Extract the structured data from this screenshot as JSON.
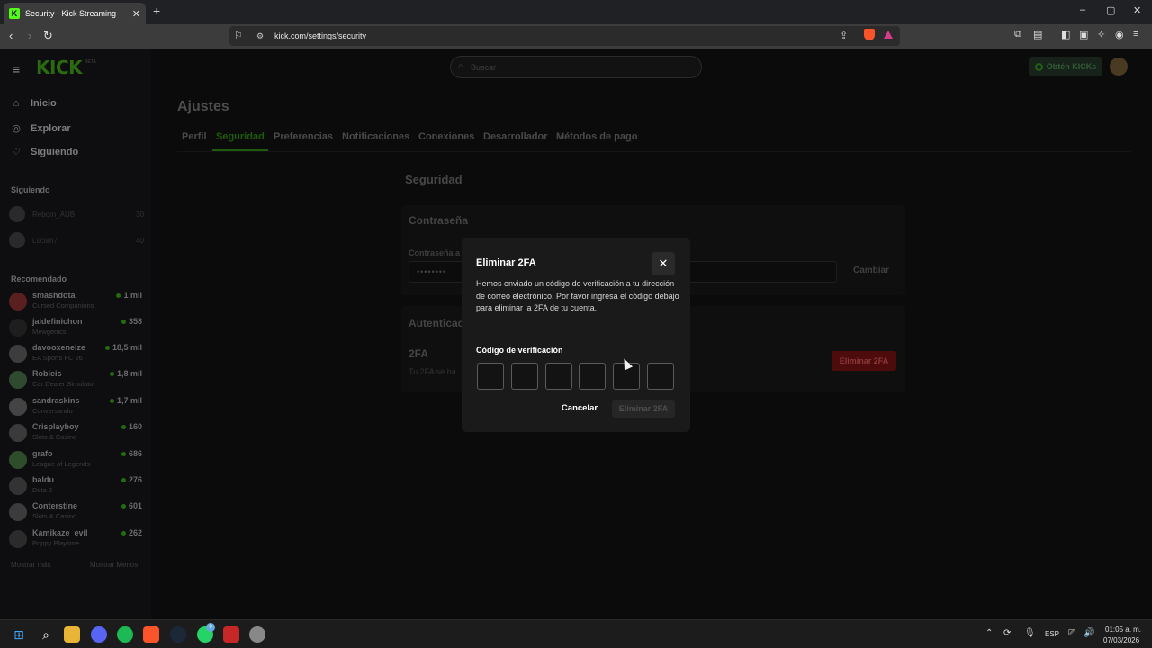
{
  "browser": {
    "tab_title": "Security - Kick Streaming",
    "favicon_letter": "K",
    "new_tab_symbol": "+",
    "url": "kick.com/settings/security",
    "window_controls": [
      "–",
      "▢",
      "✕"
    ]
  },
  "header": {
    "logo_text": "KICK",
    "logo_badge": "BETA",
    "search_placeholder": "Buscar",
    "kicks_button": "Obtén KICKs",
    "accent_color": "#53fc18"
  },
  "sidebar": {
    "nav": [
      {
        "label": "Inicio",
        "icon": "home-icon"
      },
      {
        "label": "Explorar",
        "icon": "compass-icon"
      },
      {
        "label": "Siguiendo",
        "icon": "heart-icon"
      }
    ],
    "following_title": "Siguiendo",
    "following": [
      {
        "name": "Reborn_AUB",
        "count": "30"
      },
      {
        "name": "Lucian7",
        "count": "40"
      }
    ],
    "recommended_title": "Recomendado",
    "recommended": [
      {
        "name": "smashdota",
        "category": "Cursed Companions",
        "viewers": "1 mil"
      },
      {
        "name": "jaidefinichon",
        "category": "Mewgenics",
        "viewers": "358"
      },
      {
        "name": "davooxeneize",
        "category": "EA Sports FC 26",
        "viewers": "18,5 mil"
      },
      {
        "name": "Robleis",
        "category": "Car Dealer Simulator",
        "viewers": "1,8 mil"
      },
      {
        "name": "sandraskins",
        "category": "Conversando",
        "viewers": "1,7 mil"
      },
      {
        "name": "Crisplayboy",
        "category": "Slots & Casino",
        "viewers": "160"
      },
      {
        "name": "grafo",
        "category": "League of Legends",
        "viewers": "686"
      },
      {
        "name": "baldu",
        "category": "Dota 2",
        "viewers": "276"
      },
      {
        "name": "Conterstine",
        "category": "Slots & Casino",
        "viewers": "601"
      },
      {
        "name": "Kamikaze_evil",
        "category": "Poppy Playtime",
        "viewers": "262"
      }
    ],
    "show_more": "Mostrar más",
    "show_less": "Mostrar Menos"
  },
  "settings": {
    "title": "Ajustes",
    "tabs": [
      "Perfil",
      "Seguridad",
      "Preferencias",
      "Notificaciones",
      "Conexiones",
      "Desarrollador",
      "Métodos de pago"
    ],
    "active_tab": "Seguridad",
    "section_title": "Seguridad",
    "password_card_title": "Contraseña",
    "password_label": "Contraseña a",
    "password_value": "••••••••",
    "change_button": "Cambiar",
    "auth_card_title": "Autenticac",
    "tfa_title": "2FA",
    "tfa_desc": "Tu 2FA se ha",
    "tfa_remove_button": "Eliminar 2FA"
  },
  "modal": {
    "title": "Eliminar 2FA",
    "close_symbol": "✕",
    "description": "Hemos enviado un código de verificación a tu dirección de correo electrónico. Por favor ingresa el código debajo para eliminar la 2FA de tu cuenta.",
    "code_label": "Código de verificación",
    "code_digits": [
      "",
      "",
      "",
      "",
      "",
      ""
    ],
    "cancel_button": "Cancelar",
    "confirm_button": "Eliminar 2FA"
  },
  "taskbar": {
    "apps": [
      "windows-start",
      "search",
      "file-explorer",
      "discord",
      "spotify",
      "brave",
      "steam",
      "whatsapp",
      "app-red",
      "chrome-like"
    ],
    "whatsapp_badge": "9",
    "language": "ESP",
    "time": "01:05 a. m.",
    "date": "07/03/2026"
  }
}
